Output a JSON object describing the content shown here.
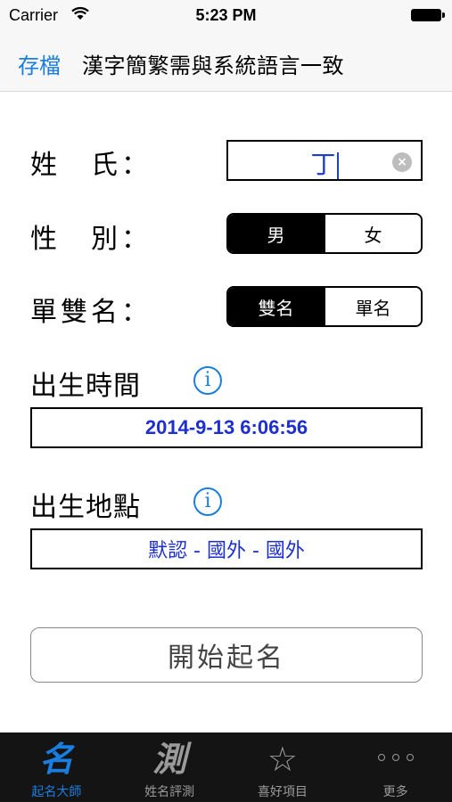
{
  "status_bar": {
    "carrier": "Carrier",
    "time": "5:23 PM"
  },
  "navbar": {
    "save_label": "存檔",
    "title": "漢字簡繁需與系統語言一致"
  },
  "form": {
    "surname": {
      "label": "姓　氏：",
      "value": "丁"
    },
    "gender": {
      "label": "性　別：",
      "options": [
        "男",
        "女"
      ],
      "selected": "男"
    },
    "name_type": {
      "label": "單雙名：",
      "options": [
        "雙名",
        "單名"
      ],
      "selected": "雙名"
    },
    "birth_time": {
      "label": "出生時間",
      "value": "2014-9-13 6:06:56"
    },
    "birth_place": {
      "label": "出生地點",
      "value": "默認 - 國外 - 國外"
    },
    "start_button": "開始起名"
  },
  "tabbar": {
    "items": [
      {
        "label": "起名大師",
        "icon": "名",
        "icon_name": "name-brush-icon",
        "active": true
      },
      {
        "label": "姓名評測",
        "icon": "測",
        "icon_name": "test-brush-icon",
        "active": false
      },
      {
        "label": "喜好項目",
        "icon": "☆",
        "icon_name": "star-icon",
        "active": false
      },
      {
        "label": "更多",
        "icon": "",
        "icon_name": "more-dots-icon",
        "active": false
      }
    ]
  },
  "colors": {
    "accent": "#1a7ee0",
    "value_text": "#1d2fd0",
    "tabbar_bg": "#141414"
  }
}
